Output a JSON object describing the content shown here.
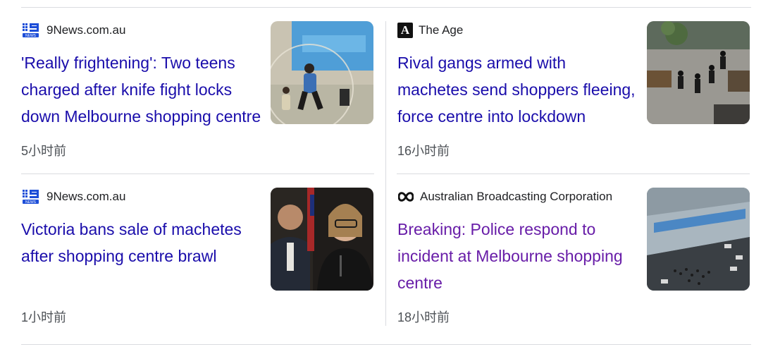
{
  "articles": [
    {
      "source": "9News.com.au",
      "source_icon": "nine-news-logo-icon",
      "headline": "'Really frightening': Two teens charged after knife fight locks down Melbourne shopping centre",
      "time": "5小时前",
      "visited": false
    },
    {
      "source": "The Age",
      "source_icon": "the-age-logo-icon",
      "headline": "Rival gangs armed with machetes send shoppers fleeing, force centre into lockdown",
      "time": "16小时前",
      "visited": false
    },
    {
      "source": "9News.com.au",
      "source_icon": "nine-news-logo-icon",
      "headline": "Victoria bans sale of machetes after shopping centre brawl",
      "time": "1小时前",
      "visited": false
    },
    {
      "source": "Australian Broadcasting Corporation",
      "source_icon": "abc-logo-icon",
      "headline": "Breaking: Police respond to incident at Melbourne shopping centre",
      "time": "18小时前",
      "visited": true
    }
  ],
  "colors": {
    "link": "#1a0dab",
    "visited_link": "#681da8",
    "meta_text": "#4d5156",
    "divider": "#dadce0",
    "nine_blue": "#1d4ed8"
  }
}
